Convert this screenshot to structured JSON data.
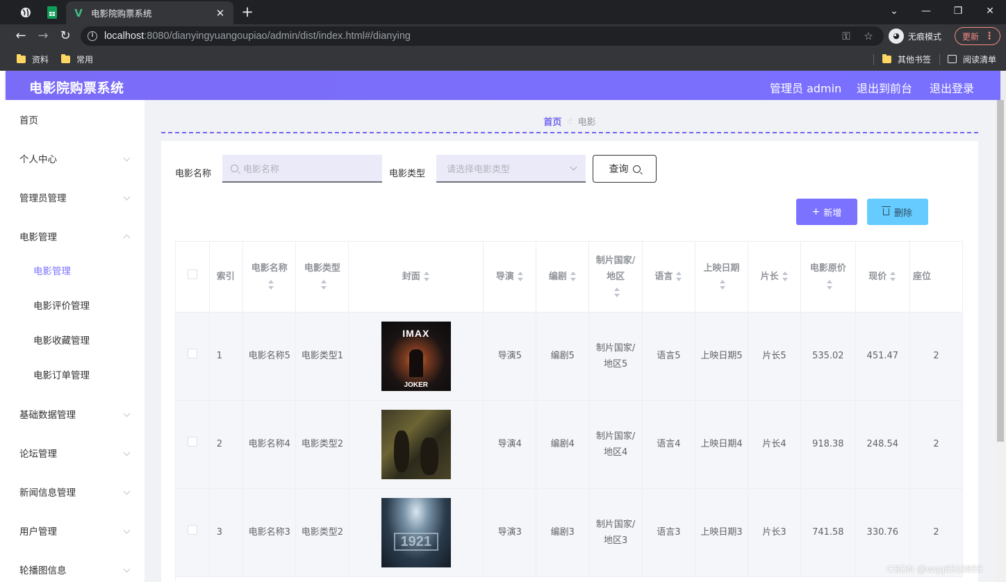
{
  "browser": {
    "tab_title": "电影院购票系统",
    "url_host": "localhost",
    "url_rest": ":8080/dianyingyuangoupiao/admin/dist/index.html#/dianying",
    "incognito_label": "无痕模式",
    "update_label": "更新",
    "bookmarks": [
      "资料",
      "常用"
    ],
    "other_bookmarks": "其他书签",
    "reading_list": "阅读清单"
  },
  "header": {
    "title": "电影院购票系统",
    "admin": "管理员 admin",
    "to_front": "退出到前台",
    "logout": "退出登录"
  },
  "sidebar": {
    "items": [
      {
        "label": "首页"
      },
      {
        "label": "个人中心"
      },
      {
        "label": "管理员管理"
      },
      {
        "label": "电影管理"
      },
      {
        "label": "电影管理"
      },
      {
        "label": "电影评价管理"
      },
      {
        "label": "电影收藏管理"
      },
      {
        "label": "电影订单管理"
      },
      {
        "label": "基础数据管理"
      },
      {
        "label": "论坛管理"
      },
      {
        "label": "新闻信息管理"
      },
      {
        "label": "用户管理"
      },
      {
        "label": "轮播图信息"
      }
    ]
  },
  "breadcrumb": {
    "home": "首页",
    "current": "电影"
  },
  "search": {
    "name_label": "电影名称",
    "name_placeholder": "电影名称",
    "type_label": "电影类型",
    "type_placeholder": "请选择电影类型",
    "query_label": "查询"
  },
  "actions": {
    "add": "新增",
    "delete": "删除"
  },
  "table": {
    "headers": [
      "索引",
      "电影名称",
      "电影类型",
      "封面",
      "导演",
      "编剧",
      "制片国家/地区",
      "语言",
      "上映日期",
      "片长",
      "电影原价",
      "现价",
      "座位"
    ],
    "rows": [
      {
        "index": "1",
        "name": "电影名称5",
        "type": "电影类型1",
        "poster": "IMAX",
        "poster_caption": "JOKER",
        "director": "导演5",
        "writer": "编剧5",
        "country": "制片国家/地区5",
        "language": "语言5",
        "date": "上映日期5",
        "length": "片长5",
        "price": "535.02",
        "now": "451.47",
        "seat": "2"
      },
      {
        "index": "2",
        "name": "电影名称4",
        "type": "电影类型2",
        "poster": "",
        "poster_caption": "",
        "director": "导演4",
        "writer": "编剧4",
        "country": "制片国家/地区4",
        "language": "语言4",
        "date": "上映日期4",
        "length": "片长4",
        "price": "918.38",
        "now": "248.54",
        "seat": "2"
      },
      {
        "index": "3",
        "name": "电影名称3",
        "type": "电影类型2",
        "poster": "1921",
        "poster_caption": "",
        "director": "导演3",
        "writer": "编剧3",
        "country": "制片国家/地区3",
        "language": "语言3",
        "date": "上映日期3",
        "length": "片长3",
        "price": "741.58",
        "now": "330.76",
        "seat": "2"
      }
    ]
  },
  "watermark": "CSDN @wqq6310855",
  "colors": {
    "accent": "#7b72ff",
    "delete": "#66ccff",
    "chrome": "#202124"
  }
}
